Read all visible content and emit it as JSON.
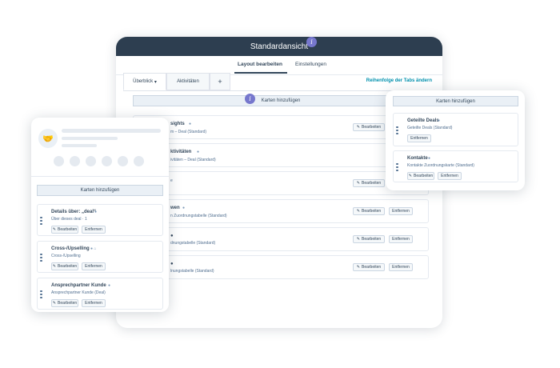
{
  "main": {
    "title": "Standardansicht",
    "info": "i",
    "subtabs": [
      "Layout bearbeiten",
      "Einstellungen"
    ],
    "tabs": [
      {
        "label": "Überblick",
        "caret": "▾"
      },
      {
        "label": "Aktivitäten"
      },
      {
        "label": "+"
      }
    ],
    "tab_order_link": "Reihenfolge der Tabs ändern",
    "add_cards": "Karten hinzufügen",
    "cards": [
      {
        "title": "sights",
        "sub": "m – Deal (Standard)",
        "buttons": [
          "Bearbeiten"
        ]
      },
      {
        "title": "ktivitäten",
        "sub": "ivitäten – Deal (Standard)",
        "buttons": []
      },
      {
        "title": "",
        "sub": "",
        "buttons": [
          "Bearbeiten"
        ]
      },
      {
        "title": "wen",
        "sub": "n Zuordnungstabelle (Standard)",
        "buttons": [
          "Bearbeiten",
          "Entfernen"
        ]
      },
      {
        "title": "",
        "sub": "dnungstabelle (Standard)",
        "buttons": [
          "Bearbeiten",
          "Entfernen"
        ]
      },
      {
        "title": "",
        "sub": "lnungstabelle (Standard)",
        "buttons": [
          "Bearbeiten",
          "Entfernen"
        ]
      }
    ]
  },
  "left": {
    "avatar_icon": "handshake-icon",
    "add_cards": "Karten hinzufügen",
    "cards": [
      {
        "title": "Details über: „deal“",
        "sub": "Über dieses deal · 1",
        "edit": "Bearbeiten",
        "remove": "Entfernen"
      },
      {
        "title": "Cross-/Upselling",
        "sub": "Cross-/Upselling",
        "edit": "Bearbeiten",
        "remove": "Entfernen"
      },
      {
        "title": "Ansprechpartner Kunde",
        "sub": "Ansprechpartner Kunde (Deal)",
        "edit": "Bearbeiten",
        "remove": "Entfernen"
      }
    ]
  },
  "right": {
    "add_cards": "Karten hinzufügen",
    "cards": [
      {
        "title": "Geteilte Deals",
        "sub": "Geteilte Deals (Standard)",
        "buttons": [
          "Entfernen"
        ]
      },
      {
        "title": "Kontakte",
        "sub": "Kontakte Zuordnungskarte (Standard)",
        "buttons": [
          "Bearbeiten",
          "Entfernen"
        ]
      }
    ]
  },
  "colors": {
    "header": "#2d3e50",
    "accent": "#7677cd",
    "link": "#0091ae"
  }
}
